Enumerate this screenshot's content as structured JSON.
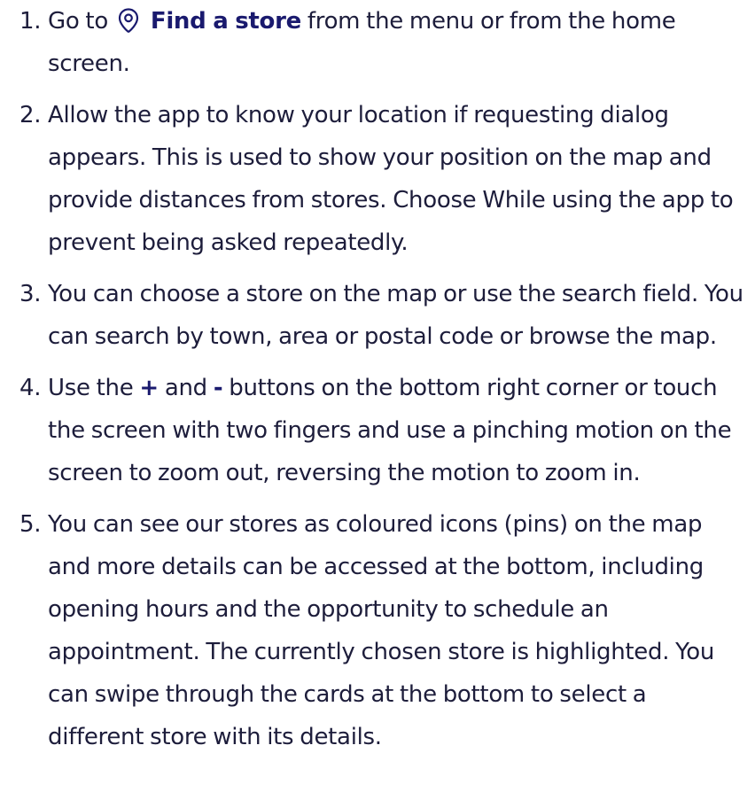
{
  "steps": [
    {
      "number": "1.",
      "pre": "Go to",
      "link_label": "Find a store",
      "post": "from the menu or from the home screen.",
      "icon": "location-pin-icon"
    },
    {
      "number": "2.",
      "text": "Allow the app to know your location if requesting dialog appears. This  is used to show your position on the map and provide distances from  stores. Choose While using the app to prevent being asked repeatedly."
    },
    {
      "number": "3.",
      "text": "You can choose a store on the map or use the search field. You can search by town, area or postal code or browse the map."
    },
    {
      "number": "4.",
      "pre": "Use the",
      "plus": "+",
      "mid": "and",
      "minus": "-",
      "post": "buttons on the bottom right corner or touch the screen  with two fingers and use a pinching motion on the screen to zoom out,  reversing the motion to zoom in."
    },
    {
      "number": "5.",
      "text": "You can see our stores as coloured icons (pins) on the map and more details can be accessed at the bottom, including opening hours and the opportunity to schedule an appointment. The currently chosen store is highlighted. You can swipe through the cards at the bottom to select a different store with its details."
    }
  ],
  "colors": {
    "text": "#1d1d3b",
    "link": "#1a1a6e"
  }
}
